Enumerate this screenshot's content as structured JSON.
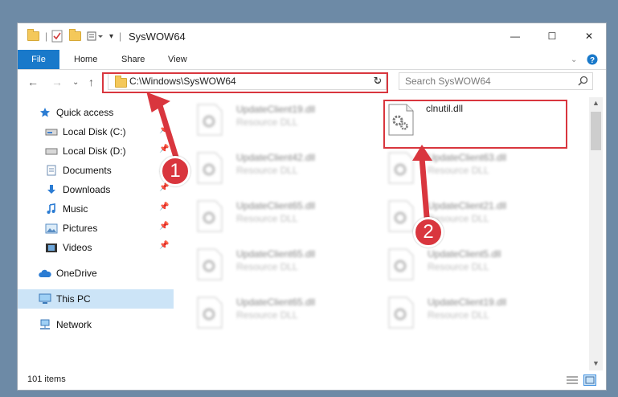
{
  "window": {
    "title": "SysWOW64",
    "minimize": "—",
    "maximize": "☐",
    "close": "✕"
  },
  "ribbon": {
    "tabs": [
      "File",
      "Home",
      "Share",
      "View"
    ]
  },
  "address": {
    "path": "C:\\Windows\\SysWOW64",
    "search_placeholder": "Search SysWOW64"
  },
  "nav": {
    "quick_access": "Quick access",
    "items": [
      {
        "label": "Local Disk (C:)",
        "pinned": true
      },
      {
        "label": "Local Disk (D:)",
        "pinned": true
      },
      {
        "label": "Documents",
        "pinned": true
      },
      {
        "label": "Downloads",
        "pinned": true
      },
      {
        "label": "Music",
        "pinned": true
      },
      {
        "label": "Pictures",
        "pinned": true
      },
      {
        "label": "Videos",
        "pinned": true
      }
    ],
    "onedrive": "OneDrive",
    "this_pc": "This PC",
    "network": "Network"
  },
  "files": {
    "highlighted": {
      "name": "clnutil.dll",
      "type": ""
    },
    "left_column": [
      {
        "name": "UpdateClient19.dll",
        "type": "Resource DLL"
      },
      {
        "name": "UpdateClient42.dll",
        "type": "Resource DLL"
      },
      {
        "name": "UpdateClient65.dll",
        "type": "Resource DLL"
      },
      {
        "name": "UpdateClient65.dll",
        "type": "Resource DLL"
      },
      {
        "name": "UpdateClient65.dll",
        "type": "Resource DLL"
      }
    ],
    "right_column": [
      {
        "name": "UpdateClient63.dll",
        "type": "Resource DLL"
      },
      {
        "name": "UpdateClient21.dll",
        "type": "Resource DLL"
      },
      {
        "name": "UpdateClient5.dll",
        "type": "Resource DLL"
      },
      {
        "name": "UpdateClient19.dll",
        "type": "Resource DLL"
      }
    ]
  },
  "status": {
    "item_count": "101 items"
  },
  "annotations": {
    "step1": "1",
    "step2": "2",
    "color": "#d9363e"
  }
}
